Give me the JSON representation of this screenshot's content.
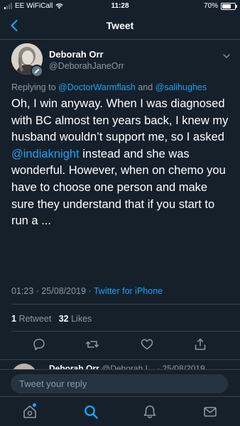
{
  "colors": {
    "background": "#15202b",
    "accent": "#1da1f2",
    "secondary_text": "#8899a6",
    "divider": "#38444d"
  },
  "status_bar": {
    "carrier": "EE WiFiCall",
    "time": "11:28",
    "battery": "70%",
    "battery_level": 0.7,
    "signal_bars": 4,
    "signal_bars_filled": 1,
    "icons": [
      "signal-icon",
      "wifi-icon",
      "battery-icon"
    ]
  },
  "nav": {
    "title": "Tweet",
    "back_icon": "chevron-left-icon"
  },
  "tweet": {
    "author_name": "Deborah Orr",
    "author_handle": "@DeborahJaneOrr",
    "reply_prefix": "Replying to",
    "reply_to_1": "@DoctorWarmflash",
    "reply_and": "and",
    "reply_to_2": "@salihughes",
    "text_part_1": "Oh, I win anyway. When I was diagnosed with BC almost ten years back, I knew my husband wouldn’t support me, so I asked",
    "mention": "@indiaknight",
    "text_part_2": "instead and she was wonderful. However, when on chemo you have to choose one person and make sure they understand that if you start to run a ...",
    "timestamp": "01:23 · 25/08/2019 ·",
    "source": "Twitter for iPhone",
    "retweet_count": "1",
    "retweet_label": "Retweet",
    "like_count": "32",
    "like_label": "Likes"
  },
  "actions": {
    "icons": [
      "reply-icon",
      "retweet-icon",
      "like-icon",
      "share-icon"
    ]
  },
  "next_reply": {
    "author_name": "Deborah Orr",
    "author_handle": "@Deborah I...",
    "date": "· 25/08/2019"
  },
  "compose": {
    "placeholder": "Tweet your reply"
  },
  "tabbar": {
    "icons": [
      "home-icon",
      "search-icon",
      "notifications-icon",
      "messages-icon"
    ]
  }
}
